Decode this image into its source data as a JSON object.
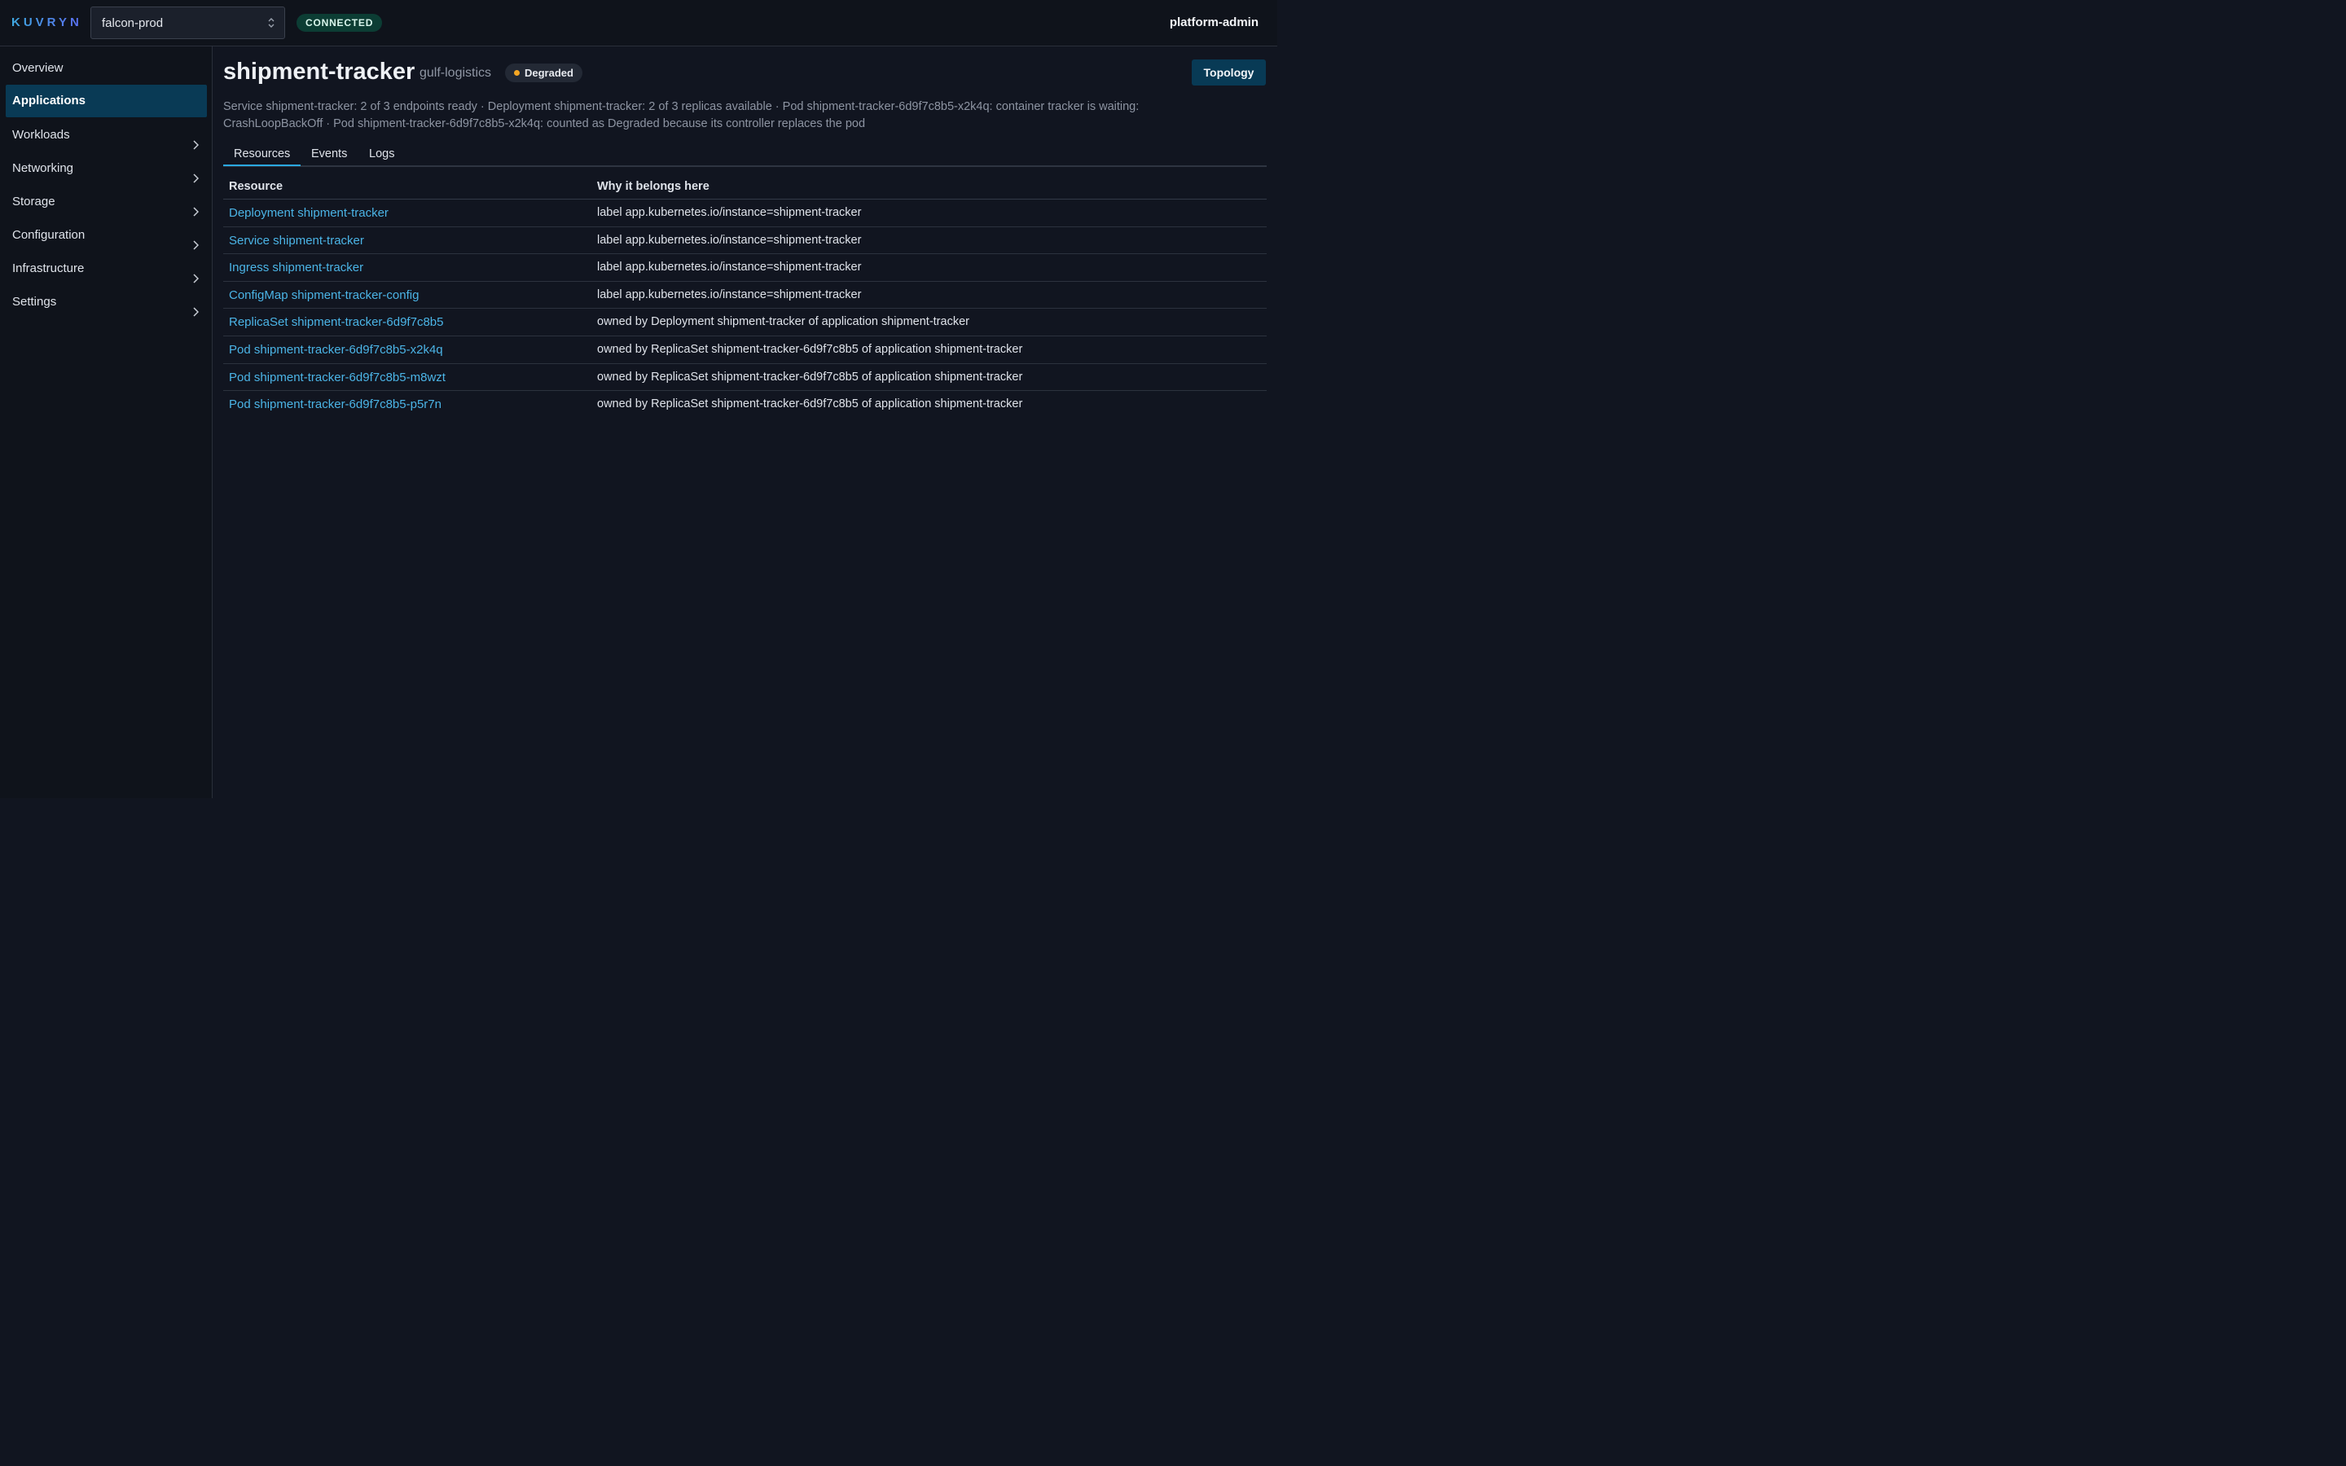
{
  "header": {
    "brand": "KUVRYN",
    "cluster": "falcon-prod",
    "connection_status": "CONNECTED",
    "user": "platform-admin"
  },
  "sidebar": {
    "items": [
      {
        "label": "Overview",
        "active": false,
        "has_children": false
      },
      {
        "label": "Applications",
        "active": true,
        "has_children": false
      },
      {
        "label": "Workloads",
        "active": false,
        "has_children": true
      },
      {
        "label": "Networking",
        "active": false,
        "has_children": true
      },
      {
        "label": "Storage",
        "active": false,
        "has_children": true
      },
      {
        "label": "Configuration",
        "active": false,
        "has_children": true
      },
      {
        "label": "Infrastructure",
        "active": false,
        "has_children": true
      },
      {
        "label": "Settings",
        "active": false,
        "has_children": true
      }
    ]
  },
  "app": {
    "name": "shipment-tracker",
    "namespace": "gulf-logistics",
    "status": "Degraded",
    "status_color": "#f5a623",
    "topology_button": "Topology",
    "summary": "Service shipment-tracker: 2 of 3 endpoints ready · Deployment shipment-tracker: 2 of 3 replicas available · Pod shipment-tracker-6d9f7c8b5-x2k4q: container tracker is waiting: CrashLoopBackOff · Pod shipment-tracker-6d9f7c8b5-x2k4q: counted as Degraded because its controller replaces the pod"
  },
  "tabs": [
    {
      "label": "Resources",
      "active": true
    },
    {
      "label": "Events",
      "active": false
    },
    {
      "label": "Logs",
      "active": false
    }
  ],
  "table": {
    "headers": [
      "Resource",
      "Why it belongs here"
    ],
    "rows": [
      {
        "resource": "Deployment shipment-tracker",
        "reason": "label app.kubernetes.io/instance=shipment-tracker"
      },
      {
        "resource": "Service shipment-tracker",
        "reason": "label app.kubernetes.io/instance=shipment-tracker"
      },
      {
        "resource": "Ingress shipment-tracker",
        "reason": "label app.kubernetes.io/instance=shipment-tracker"
      },
      {
        "resource": "ConfigMap shipment-tracker-config",
        "reason": "label app.kubernetes.io/instance=shipment-tracker"
      },
      {
        "resource": "ReplicaSet shipment-tracker-6d9f7c8b5",
        "reason": "owned by Deployment shipment-tracker of application shipment-tracker"
      },
      {
        "resource": "Pod shipment-tracker-6d9f7c8b5-x2k4q",
        "reason": "owned by ReplicaSet shipment-tracker-6d9f7c8b5 of application shipment-tracker"
      },
      {
        "resource": "Pod shipment-tracker-6d9f7c8b5-m8wzt",
        "reason": "owned by ReplicaSet shipment-tracker-6d9f7c8b5 of application shipment-tracker"
      },
      {
        "resource": "Pod shipment-tracker-6d9f7c8b5-p5r7n",
        "reason": "owned by ReplicaSet shipment-tracker-6d9f7c8b5 of application shipment-tracker"
      }
    ]
  }
}
